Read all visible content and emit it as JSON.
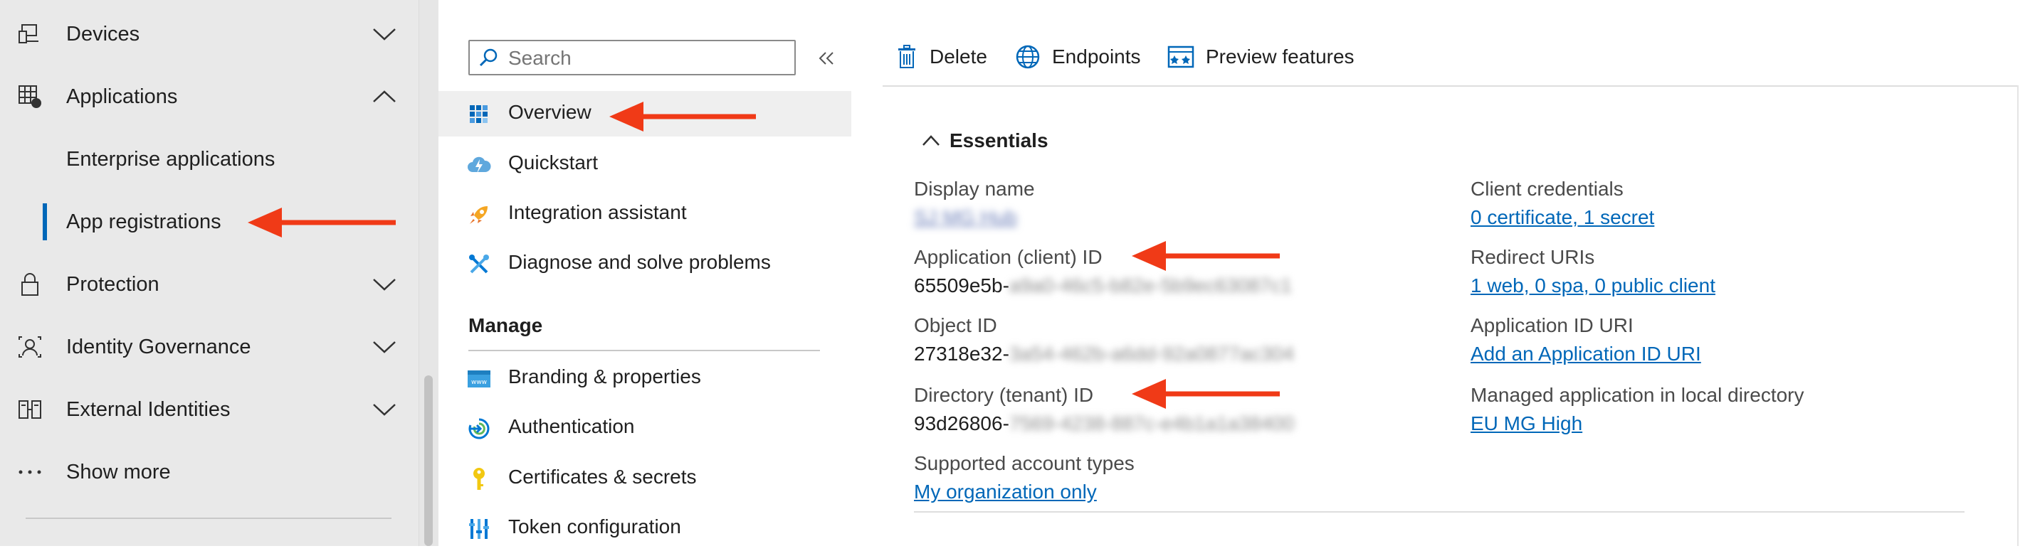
{
  "left_nav": {
    "items": [
      {
        "label": "Devices",
        "icon": "devices-icon",
        "expanded": false
      },
      {
        "label": "Applications",
        "icon": "applications-icon",
        "expanded": true
      },
      {
        "label": "Enterprise applications"
      },
      {
        "label": "App registrations",
        "selected": true
      },
      {
        "label": "Protection",
        "icon": "lock-icon",
        "expanded": false
      },
      {
        "label": "Identity Governance",
        "icon": "identity-governance-icon",
        "expanded": false
      },
      {
        "label": "External Identities",
        "icon": "external-identities-icon",
        "expanded": false
      },
      {
        "label": "Show more",
        "icon": "more-icon"
      }
    ]
  },
  "mid_menu": {
    "search_placeholder": "Search",
    "items": [
      {
        "label": "Overview",
        "icon": "overview-grid-icon",
        "selected": true
      },
      {
        "label": "Quickstart",
        "icon": "quickstart-cloud-icon"
      },
      {
        "label": "Integration assistant",
        "icon": "rocket-icon"
      },
      {
        "label": "Diagnose and solve problems",
        "icon": "wrench-icon"
      }
    ],
    "manage_heading": "Manage",
    "manage_items": [
      {
        "label": "Branding & properties",
        "icon": "branding-icon"
      },
      {
        "label": "Authentication",
        "icon": "authentication-icon"
      },
      {
        "label": "Certificates & secrets",
        "icon": "key-icon"
      },
      {
        "label": "Token configuration",
        "icon": "token-bars-icon"
      }
    ]
  },
  "toolbar": {
    "delete_label": "Delete",
    "endpoints_label": "Endpoints",
    "preview_label": "Preview features"
  },
  "essentials": {
    "heading": "Essentials",
    "left": [
      {
        "label": "Display name",
        "value": "SJ MG Hub"
      },
      {
        "label": "Application (client) ID",
        "value_prefix": "65509e5b-",
        "value_hidden": "a9a0-46c5-b82e-5b9ec63087c1"
      },
      {
        "label": "Object ID",
        "value_prefix": "27318e32-",
        "value_hidden": "3a54-462b-a6dd-92a0877ac304"
      },
      {
        "label": "Directory (tenant) ID",
        "value_prefix": "93d26806-",
        "value_hidden": "7569-4238-887c-e4b1a1a38400"
      },
      {
        "label": "Supported account types",
        "value": "My organization only"
      }
    ],
    "right": [
      {
        "label": "Client credentials",
        "value": "0 certificate, 1 secret"
      },
      {
        "label": "Redirect URIs",
        "value": "1 web, 0 spa, 0 public client"
      },
      {
        "label": "Application ID URI",
        "value": "Add an Application ID URI"
      },
      {
        "label": "Managed application in local directory",
        "value": "EU MG High"
      }
    ]
  },
  "colors": {
    "accent": "#0067b8",
    "arrow": "#f03a17",
    "selected_bg": "#efefef"
  }
}
